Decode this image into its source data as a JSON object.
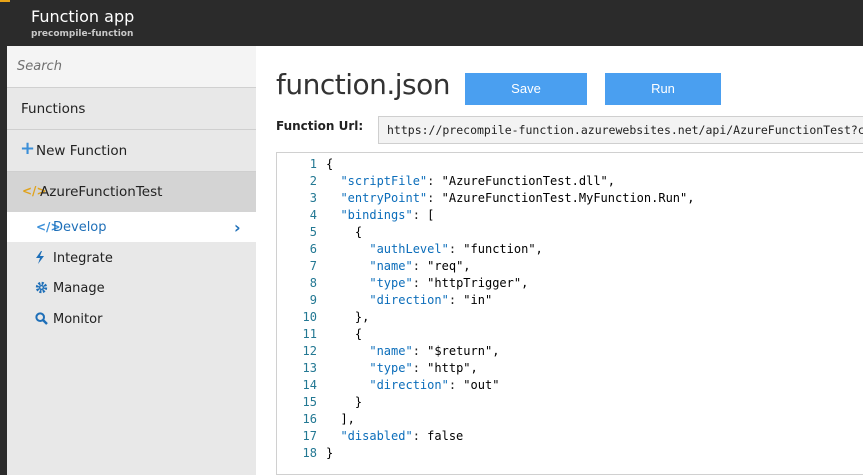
{
  "header": {
    "title": "Function app",
    "subtitle": "precompile-function"
  },
  "sidebar": {
    "search_placeholder": "Search",
    "functions_heading": "Functions",
    "new_function_label": "New Function",
    "function_name": "AzureFunctionTest",
    "items": [
      {
        "label": "Develop",
        "icon": "code-icon"
      },
      {
        "label": "Integrate",
        "icon": "lightning-icon"
      },
      {
        "label": "Manage",
        "icon": "gear-icon"
      },
      {
        "label": "Monitor",
        "icon": "search-icon"
      }
    ]
  },
  "main": {
    "title": "function.json",
    "save_label": "Save",
    "run_label": "Run",
    "url_label": "Function Url:",
    "url_value": "https://precompile-function.azurewebsites.net/api/AzureFunctionTest?code="
  },
  "colors": {
    "accent_blue": "#4a9ff0",
    "header_bg": "#2b2b2b",
    "sidebar_bg": "#e8e8e8",
    "key_blue": "#0b6dba"
  },
  "editor": {
    "lines": [
      {
        "n": "1",
        "t": "{"
      },
      {
        "n": "2",
        "t": "  \"scriptFile\": \"AzureFunctionTest.dll\","
      },
      {
        "n": "3",
        "t": "  \"entryPoint\": \"AzureFunctionTest.MyFunction.Run\","
      },
      {
        "n": "4",
        "t": "  \"bindings\": ["
      },
      {
        "n": "5",
        "t": "    {"
      },
      {
        "n": "6",
        "t": "      \"authLevel\": \"function\","
      },
      {
        "n": "7",
        "t": "      \"name\": \"req\","
      },
      {
        "n": "8",
        "t": "      \"type\": \"httpTrigger\","
      },
      {
        "n": "9",
        "t": "      \"direction\": \"in\""
      },
      {
        "n": "10",
        "t": "    },"
      },
      {
        "n": "11",
        "t": "    {"
      },
      {
        "n": "12",
        "t": "      \"name\": \"$return\","
      },
      {
        "n": "13",
        "t": "      \"type\": \"http\","
      },
      {
        "n": "14",
        "t": "      \"direction\": \"out\""
      },
      {
        "n": "15",
        "t": "    }"
      },
      {
        "n": "16",
        "t": "  ],"
      },
      {
        "n": "17",
        "t": "  \"disabled\": false"
      },
      {
        "n": "18",
        "t": "}"
      }
    ]
  }
}
